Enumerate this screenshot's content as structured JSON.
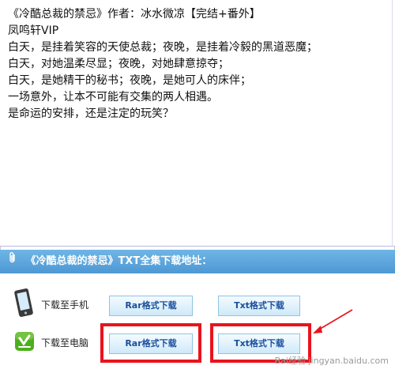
{
  "book_info": {
    "lines": [
      "《冷酷总裁的禁忌》作者：冰水微凉【完结+番外】",
      "凤鸣轩VIP",
      "白天，是挂着笑容的天使总裁；夜晚，是挂着冷毅的黑道恶魔；",
      "白天，对她温柔尽显；夜晚，对她肆意掠夺；",
      "白天，是她精干的秘书；夜晚，是她可人的床伴；",
      "一场意外，让本不可能有交集的两人相遇。",
      "是命运的安排，还是注定的玩笑？"
    ]
  },
  "download": {
    "header": "《冷酷总裁的禁忌》TXT全集下载地址：",
    "header_icon": "paperclip-icon",
    "rows": [
      {
        "icon": "mobile-phone-icon",
        "label": "下载至手机",
        "rar_label": "Rar格式下载",
        "txt_label": "Txt格式下载"
      },
      {
        "icon": "download-check-icon",
        "label": "下载至电脑",
        "rar_label": "Rar格式下载",
        "txt_label": "Txt格式下载"
      }
    ]
  },
  "annotations": {
    "highlight_color": "#e8141d",
    "arrow_color": "#e8141d"
  },
  "watermark": "Bai经验 jingyan.baidu.com"
}
